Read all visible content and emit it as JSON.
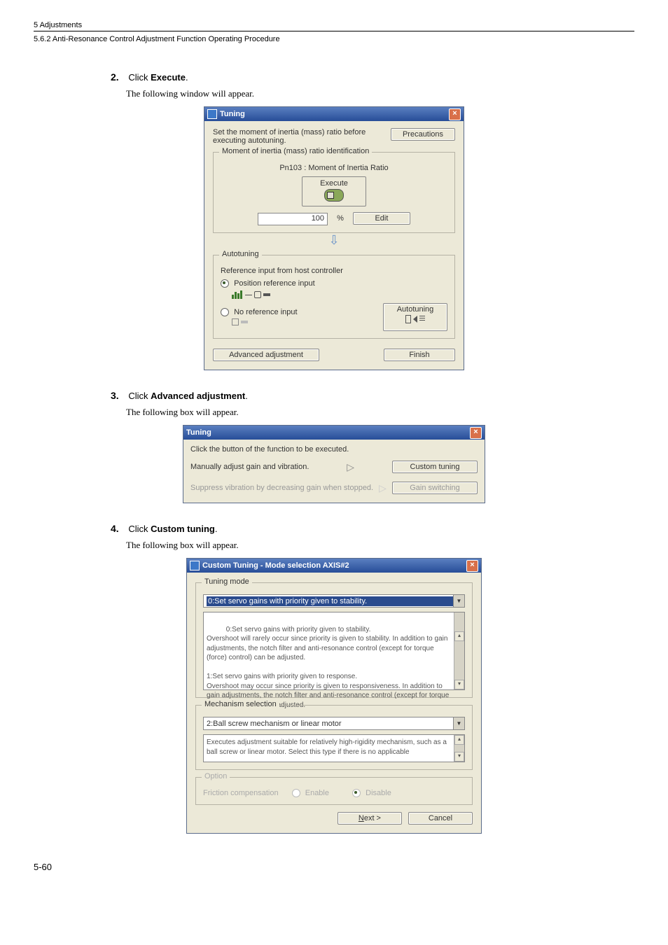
{
  "header": {
    "line1": "5  Adjustments",
    "line2": "5.6.2  Anti-Resonance Control Adjustment Function Operating Procedure"
  },
  "steps": {
    "s2": {
      "num": "2.",
      "instr_pre": "Click ",
      "instr_bold": "Execute",
      "instr_post": ".",
      "sub": "The following window will appear."
    },
    "s3": {
      "num": "3.",
      "instr_pre": "Click ",
      "instr_bold": "Advanced adjustment",
      "instr_post": ".",
      "sub": "The following box will appear."
    },
    "s4": {
      "num": "4.",
      "instr_pre": "Click ",
      "instr_bold": "Custom tuning",
      "instr_post": ".",
      "sub": "The following box will appear."
    }
  },
  "dialogA": {
    "title": "Tuning",
    "intro": "Set the moment of inertia (mass) ratio before executing autotuning.",
    "precautions": "Precautions",
    "group1_title": "Moment of inertia (mass) ratio identification",
    "pn103_label": "Pn103 : Moment of Inertia Ratio",
    "execute": "Execute",
    "value": "100",
    "unit": "%",
    "edit": "Edit",
    "group2_title": "Autotuning",
    "ref_label": "Reference input from host controller",
    "opt1": "Position reference input",
    "opt2": "No reference input",
    "autotuning": "Autotuning",
    "advanced": "Advanced adjustment",
    "finish": "Finish"
  },
  "dialogB": {
    "title": "Tuning",
    "instr": "Click the button of the function to be executed.",
    "row1_label": "Manually adjust gain and vibration.",
    "row1_btn": "Custom tuning",
    "row2_label": "Suppress vibration by decreasing gain when stopped.",
    "row2_btn": "Gain switching"
  },
  "dialogC": {
    "title": "Custom Tuning - Mode selection AXIS#2",
    "g1_title": "Tuning mode",
    "g1_drop": "0:Set servo gains with priority given to stability.",
    "g1_text": "0:Set servo gains with priority given to stability.\nOvershoot will rarely occur since priority is given to stability. In addition to gain adjustments, the notch filter and anti-resonance control (except for torque (force) control) can be adjusted.\n\n1:Set servo gains with priority given to response.\nOvershoot may occur since priority is given to responsiveness. In addition to gain adjustments, the notch filter and anti-resonance control (except for torque (force) control) can be adjusted.",
    "g2_title": "Mechanism selection",
    "g2_drop": "2:Ball screw mechanism or linear motor",
    "g2_text": "Executes adjustment suitable for relatively high-rigidity mechanism, such as a ball screw or linear motor. Select this type if there is no applicable",
    "g3_title": "Option",
    "g3_label": "Friction compensation",
    "g3_opt1": "Enable",
    "g3_opt2": "Disable",
    "next": "Next >",
    "cancel": "Cancel"
  },
  "footer_page": "5-60"
}
